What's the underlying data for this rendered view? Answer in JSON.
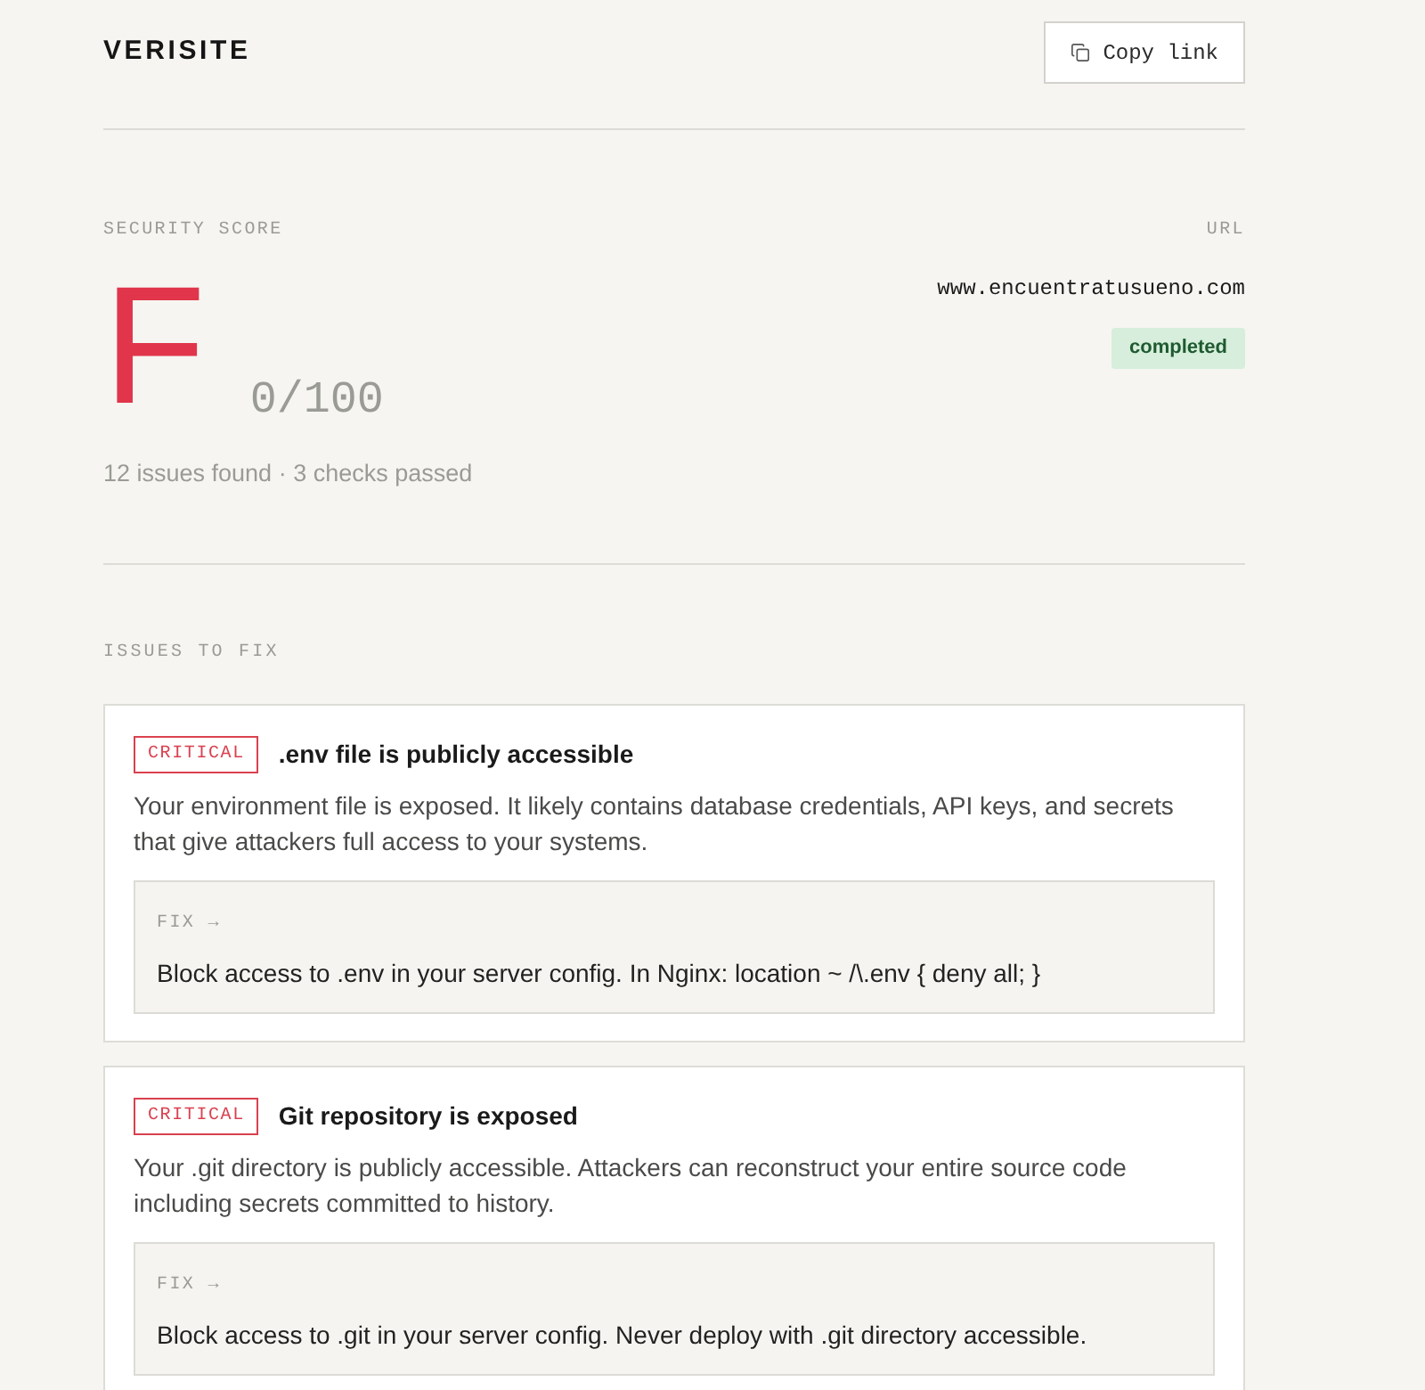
{
  "header": {
    "logo": "VERISITE",
    "copy_button": "Copy link"
  },
  "score": {
    "label": "SECURITY SCORE",
    "grade": "F",
    "points": "0/100",
    "summary": "12 issues found · 3 checks passed"
  },
  "site": {
    "label": "URL",
    "url": "www.encuentratusueno.com",
    "status": {
      "kind": "completed",
      "label": "completed"
    }
  },
  "issues_section": {
    "title": "ISSUES TO FIX",
    "issues": [
      {
        "kind": "critical",
        "badge": "CRITICAL",
        "title": ".env file is publicly accessible",
        "description": "Your environment file is exposed. It likely contains database credentials, API keys, and secrets that give attackers full access to your systems.",
        "fix_label": "FIX →",
        "fix": "Block access to .env in your server config. In Nginx: location ~ /\\.env { deny all; }"
      },
      {
        "kind": "critical",
        "badge": "CRITICAL",
        "title": "Git repository is exposed",
        "description": "Your .git directory is publicly accessible. Attackers can reconstruct your entire source code including secrets committed to history.",
        "fix_label": "FIX →",
        "fix": "Block access to .git in your server config. Never deploy with .git directory accessible."
      }
    ]
  }
}
